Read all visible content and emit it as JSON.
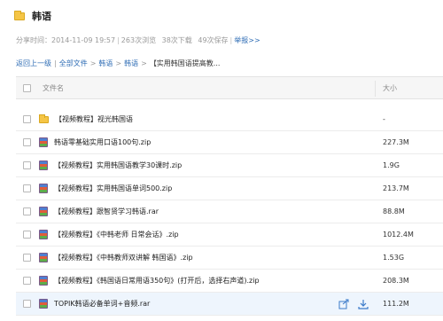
{
  "header": {
    "title": "韩语"
  },
  "meta": {
    "share_time": "分享时间：2014-11-09 19:57",
    "views": "263次浏览",
    "downloads": "38次下载",
    "saves": "49次保存",
    "report": "举报>>"
  },
  "breadcrumb": {
    "back": "返回上一级",
    "all_files": "全部文件",
    "level1": "韩语",
    "level2": "韩语",
    "current": "【实用韩国语提高教..."
  },
  "columns": {
    "name": "文件名",
    "size": "大小"
  },
  "files": [
    {
      "name": "【视频教程】视光韩国语",
      "size": "-",
      "type": "folder"
    },
    {
      "name": "韩语零基础实用口语100句.zip",
      "size": "227.3M",
      "type": "zip"
    },
    {
      "name": "【视频教程】实用韩国语教学30课时.zip",
      "size": "1.9G",
      "type": "zip"
    },
    {
      "name": "【视频教程】实用韩国语单词500.zip",
      "size": "213.7M",
      "type": "zip"
    },
    {
      "name": "【视频教程】跟智贤学习韩语.rar",
      "size": "88.8M",
      "type": "zip"
    },
    {
      "name": "【视频教程】《中韩老师 日常会话》.zip",
      "size": "1012.4M",
      "type": "zip"
    },
    {
      "name": "【视频教程】《中韩教师双讲解 韩国语》.zip",
      "size": "1.53G",
      "type": "zip"
    },
    {
      "name": "【视频教程】《韩国语日常用语350句》(打开后，选择右声道).zip",
      "size": "208.3M",
      "type": "zip"
    },
    {
      "name": "TOPIK韩语必备单词+音频.rar",
      "size": "111.2M",
      "type": "zip"
    }
  ],
  "colors": {
    "link": "#2f6db5",
    "hover_row": "#eef5fd",
    "folder": "#f5c546"
  }
}
